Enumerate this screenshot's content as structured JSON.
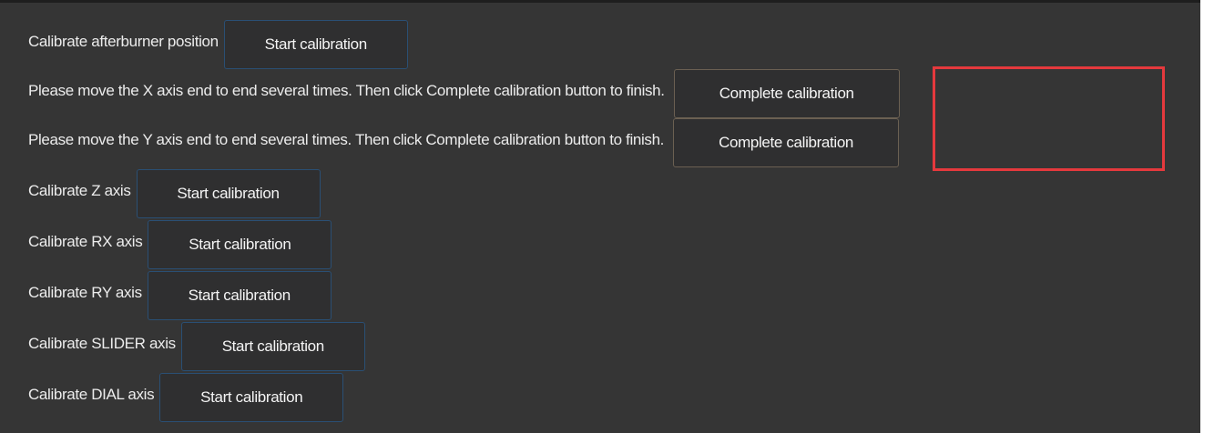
{
  "rows": [
    {
      "label": "Calibrate afterburner position",
      "button": "Start calibration"
    },
    {
      "label": "Please move the X axis end to end several times. Then click Complete calibration button to finish.",
      "button": "Complete calibration"
    },
    {
      "label": "Please move the Y axis end to end several times. Then click Complete calibration button to finish.",
      "button": "Complete calibration"
    },
    {
      "label": "Calibrate Z axis",
      "button": "Start calibration"
    },
    {
      "label": "Calibrate RX axis",
      "button": "Start calibration"
    },
    {
      "label": "Calibrate RY axis",
      "button": "Start calibration"
    },
    {
      "label": "Calibrate SLIDER axis",
      "button": "Start calibration"
    },
    {
      "label": "Calibrate DIAL axis",
      "button": "Start calibration"
    }
  ],
  "colors": {
    "background": "#353535",
    "text": "#ececec",
    "button_border": "#2a4f74",
    "highlight": "#e5393d"
  }
}
